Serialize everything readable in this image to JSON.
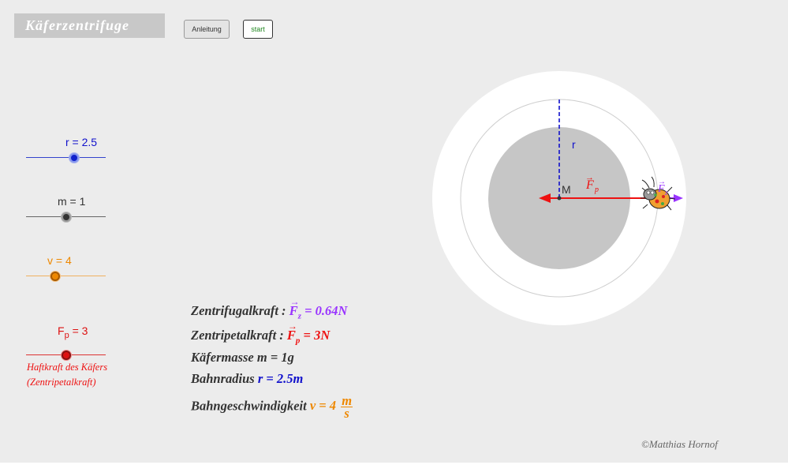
{
  "app": {
    "title": "Käferzentrifuge"
  },
  "buttons": {
    "help_label": "Anleitung",
    "start_label": "start"
  },
  "sliders": {
    "r": {
      "label": "r = 2.5",
      "value": 2.5,
      "color": "#1111cc"
    },
    "m": {
      "label": "m = 1",
      "value": 1,
      "color": "#333333"
    },
    "v": {
      "label": "v = 4",
      "value": 4,
      "color": "#ee8800"
    },
    "fp": {
      "label_main": "F",
      "label_sub": "p",
      "label_rest": " = 3",
      "value": 3,
      "color": "#dd1111"
    }
  },
  "haftkraft": {
    "line1": "Haftkraft des Käfers",
    "line2": "(Zentripetalkraft)"
  },
  "info": {
    "zentrifugal_label": "Zentrifugalkraft : ",
    "zentrifugal_sym": "F",
    "zentrifugal_sub": "z",
    "zentrifugal_val": " = 0.64N",
    "zentripetal_label": "Zentripetalkraft : ",
    "zentripetal_sym": "F",
    "zentripetal_sub": "p",
    "zentripetal_val": " = 3N",
    "masse_label": "Käfermasse ",
    "masse_val": "m = 1g",
    "radius_label": "Bahnradius ",
    "radius_val": "r = 2.5m",
    "speed_label": "Bahngeschwindigkeit ",
    "speed_val": "v = 4",
    "speed_unit_num": "m",
    "speed_unit_den": "s"
  },
  "diagram": {
    "center_label": "M",
    "radius_label": "r",
    "fp_symbol": "F",
    "fp_sub": "p",
    "fz_symbol": "F",
    "fz_sub": "z"
  },
  "colors": {
    "zentrifugal": "#9933ff",
    "zentripetal": "#ee1111",
    "radius": "#1111cc",
    "speed": "#ee8800"
  },
  "copyright": "©Matthias Hornof"
}
